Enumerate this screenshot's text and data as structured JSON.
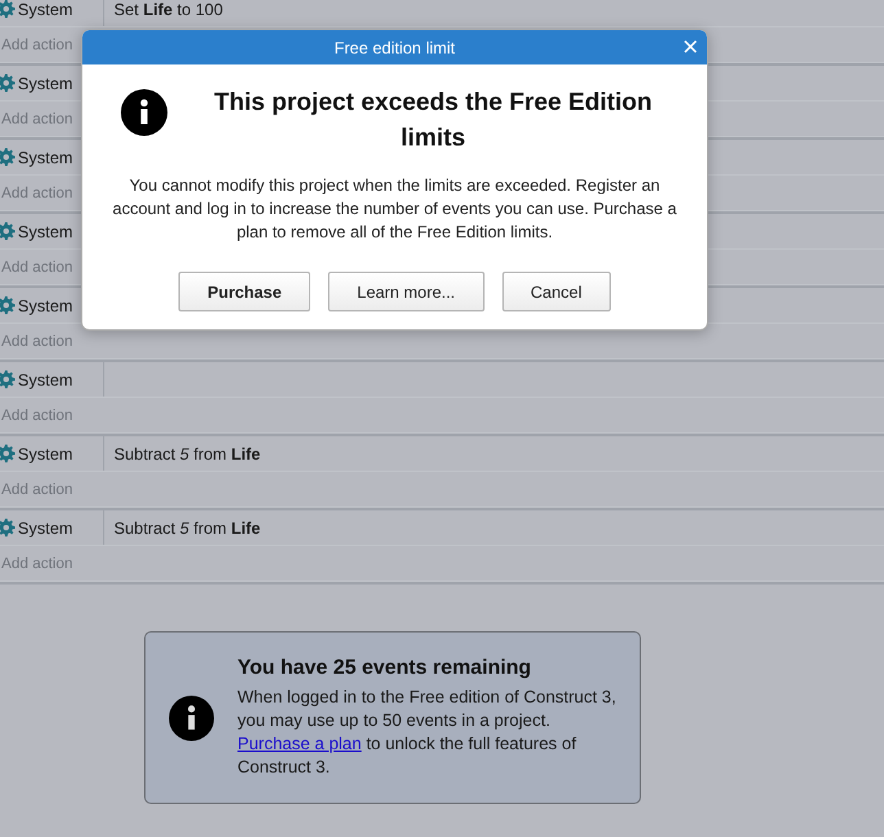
{
  "events": [
    {
      "condition": "System",
      "action": "Set **Life** to 100",
      "add_action": "Add action"
    },
    {
      "condition": "System",
      "add_action": "Add action"
    },
    {
      "condition": "System",
      "add_action": "Add action"
    },
    {
      "condition": "System",
      "add_action": "Add action"
    },
    {
      "condition": "System",
      "add_action": "Add action"
    },
    {
      "condition": "System",
      "add_action": "Add action"
    },
    {
      "condition": "System",
      "action": "Subtract *5* from **Life**",
      "add_action": "Add action"
    },
    {
      "condition": "System",
      "action": "Subtract *5* from **Life**",
      "add_action": "Add action"
    }
  ],
  "dialog": {
    "title": "Free edition limit",
    "heading": "This project exceeds the Free Edition limits",
    "message": "You cannot modify this project when the limits are exceeded. Register an account and log in to increase the number of events you can use. Purchase a plan to remove all of the Free Edition limits.",
    "buttons": [
      {
        "label": "Purchase",
        "default": true
      },
      {
        "label": "Learn more...",
        "default": false
      },
      {
        "label": "Cancel",
        "default": false
      }
    ]
  },
  "notice": {
    "title": "You have 25 events remaining",
    "text_before": "When logged in to the Free edition of Construct 3, you may use up to 50 events in a project.",
    "link": "Purchase a plan",
    "text_after": "to unlock the full features of Construct 3."
  }
}
